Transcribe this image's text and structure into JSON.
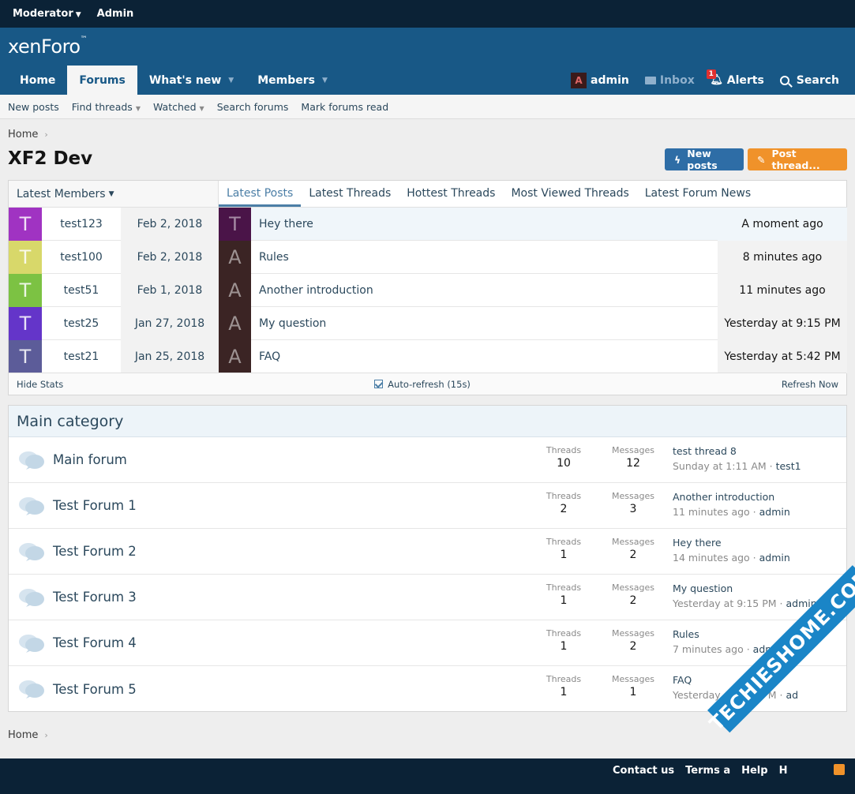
{
  "staff_bar": {
    "moderator": "Moderator",
    "admin": "Admin"
  },
  "logo": {
    "text": "xenForo",
    "tm": "™"
  },
  "nav": {
    "tabs": [
      {
        "label": "Home"
      },
      {
        "label": "Forums"
      },
      {
        "label": "What's new"
      },
      {
        "label": "Members"
      }
    ],
    "user": {
      "avatar_letter": "A",
      "name": "admin"
    },
    "inbox": "Inbox",
    "alerts": {
      "label": "Alerts",
      "badge": "1"
    },
    "search": "Search"
  },
  "subnav": [
    "New posts",
    "Find threads",
    "Watched",
    "Search forums",
    "Mark forums read"
  ],
  "breadcrumb": {
    "home": "Home",
    "sep": "›"
  },
  "page_title": "XF2 Dev",
  "buttons": {
    "new_posts": "New posts",
    "post_thread": "Post thread..."
  },
  "widget": {
    "members_header": "Latest Members",
    "members": [
      {
        "letter": "T",
        "name": "test123",
        "date": "Feb 2, 2018",
        "color": "#a033c2"
      },
      {
        "letter": "T",
        "name": "test100",
        "date": "Feb 2, 2018",
        "color": "#d8d86a"
      },
      {
        "letter": "T",
        "name": "test51",
        "date": "Feb 1, 2018",
        "color": "#7cc243"
      },
      {
        "letter": "T",
        "name": "test25",
        "date": "Jan 27, 2018",
        "color": "#6435c9"
      },
      {
        "letter": "T",
        "name": "test21",
        "date": "Jan 25, 2018",
        "color": "#5c5c99"
      }
    ],
    "tabs": [
      "Latest Posts",
      "Latest Threads",
      "Hottest Threads",
      "Most Viewed Threads",
      "Latest Forum News"
    ],
    "posts": [
      {
        "letter": "T",
        "title": "Hey there",
        "time": "A moment ago",
        "color": "#4a1448"
      },
      {
        "letter": "A",
        "title": "Rules",
        "time": "8 minutes ago",
        "color": "#3b2424"
      },
      {
        "letter": "A",
        "title": "Another introduction",
        "time": "11 minutes ago",
        "color": "#3b2424"
      },
      {
        "letter": "A",
        "title": "My question",
        "time": "Yesterday at 9:15 PM",
        "color": "#3b2424"
      },
      {
        "letter": "A",
        "title": "FAQ",
        "time": "Yesterday at 5:42 PM",
        "color": "#3b2424"
      }
    ],
    "footer": {
      "hide_stats": "Hide Stats",
      "auto_refresh": "Auto-refresh (15s)",
      "refresh_now": "Refresh Now"
    }
  },
  "category": {
    "title": "Main category",
    "threads_label": "Threads",
    "messages_label": "Messages",
    "forums": [
      {
        "name": "Main forum",
        "threads": "10",
        "messages": "12",
        "last_title": "test thread 8",
        "last_time": "Sunday at 1:11 AM",
        "last_user": "test1"
      },
      {
        "name": "Test Forum 1",
        "threads": "2",
        "messages": "3",
        "last_title": "Another introduction",
        "last_time": "11 minutes ago",
        "last_user": "admin"
      },
      {
        "name": "Test Forum 2",
        "threads": "1",
        "messages": "2",
        "last_title": "Hey there",
        "last_time": "14 minutes ago",
        "last_user": "admin"
      },
      {
        "name": "Test Forum 3",
        "threads": "1",
        "messages": "2",
        "last_title": "My question",
        "last_time": "Yesterday at 9:15 PM",
        "last_user": "admin"
      },
      {
        "name": "Test Forum 4",
        "threads": "1",
        "messages": "2",
        "last_title": "Rules",
        "last_time": "7 minutes ago",
        "last_user": "admin"
      },
      {
        "name": "Test Forum 5",
        "threads": "1",
        "messages": "1",
        "last_title": "FAQ",
        "last_time": "Yesterday at 5:42 PM",
        "last_user": "ad"
      }
    ]
  },
  "footer": {
    "links": [
      "Contact us",
      "Terms a",
      "Help",
      "H"
    ]
  },
  "watermark": "TECHIESHOME.COM"
}
